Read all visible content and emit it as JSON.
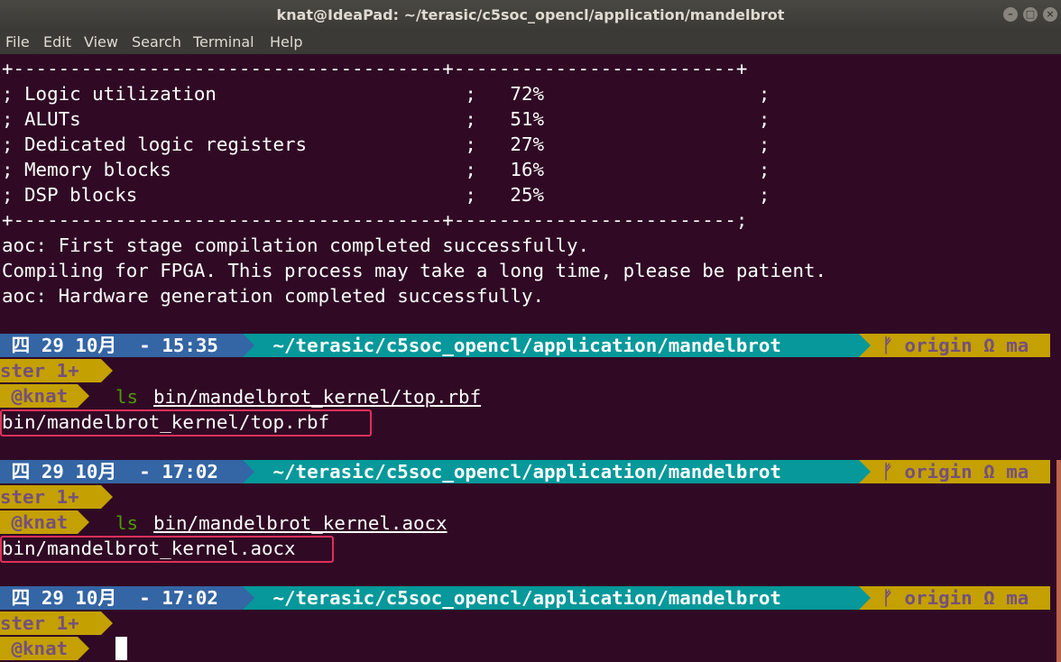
{
  "window": {
    "title": "knat@IdeaPad: ~/terasic/c5soc_opencl/application/mandelbrot",
    "controls": [
      "minimize",
      "maximize",
      "close"
    ]
  },
  "menu": [
    "File",
    "Edit",
    "View",
    "Search",
    "Terminal",
    "Help"
  ],
  "table": {
    "top_border": "+--------------------------------------+-------------------------+",
    "rows": [
      "; Logic utilization                      ;   72%                   ;",
      "; ALUTs                                  ;   51%                   ;",
      "; Dedicated logic registers              ;   27%                   ;",
      "; Memory blocks                          ;   16%                   ;",
      "; DSP blocks                             ;   25%                   ;"
    ],
    "bottom_border": "+--------------------------------------+-------------------------;"
  },
  "output": [
    "aoc: First stage compilation completed successfully.",
    "Compiling for FPGA. This process may take a long time, please be patient.",
    "aoc: Hardware generation completed successfully."
  ],
  "prompts": [
    {
      "datetime": " 四 29 10月  - 15:35 ",
      "path": " ~/terasic/c5soc_opencl/application/mandelbrot ",
      "git": " ᚠ origin Ω ma",
      "branch": "ster 1+",
      "user": " @knat ",
      "cmd": "ls",
      "arg": "bin/mandelbrot_kernel/top.rbf",
      "result": "bin/mandelbrot_kernel/top.rbf"
    },
    {
      "datetime": " 四 29 10月  - 17:02 ",
      "path": " ~/terasic/c5soc_opencl/application/mandelbrot ",
      "git": " ᚠ origin Ω ma",
      "branch": "ster 1+",
      "user": " @knat ",
      "cmd": "ls",
      "arg": "bin/mandelbrot_kernel.aocx",
      "result": "bin/mandelbrot_kernel.aocx"
    },
    {
      "datetime": " 四 29 10月  - 17:02 ",
      "path": " ~/terasic/c5soc_opencl/application/mandelbrot ",
      "git": " ᚠ origin Ω ma",
      "branch": "ster 1+",
      "user": " @knat "
    }
  ],
  "colors": {
    "bg": "#300a24",
    "date_seg": "#3465a4",
    "path_seg": "#06989a",
    "git_seg": "#c4a000",
    "git_text": "#75507b",
    "cmd": "#4e9a06",
    "highlight": "#e0305a"
  }
}
